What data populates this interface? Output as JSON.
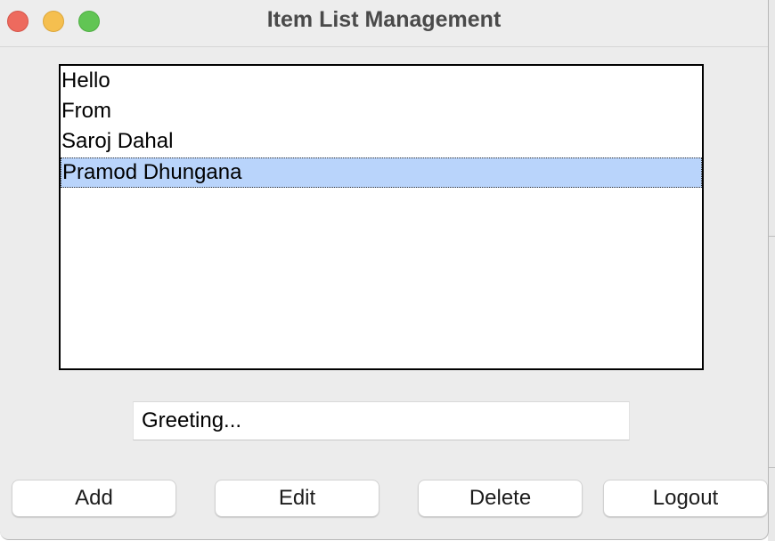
{
  "window": {
    "title": "Item List Management"
  },
  "titlebar": {
    "close_color": "#ED6A5E",
    "minimize_color": "#F5BF4F",
    "maximize_color": "#61C554"
  },
  "listbox": {
    "items": [
      {
        "label": "Hello",
        "selected": false
      },
      {
        "label": "From",
        "selected": false
      },
      {
        "label": "Saroj Dahal",
        "selected": false
      },
      {
        "label": "Pramod Dhungana",
        "selected": true
      }
    ],
    "selection_color": "#B9D4FB"
  },
  "entry": {
    "value": "Greeting..."
  },
  "buttons": {
    "add": "Add",
    "edit": "Edit",
    "delete": "Delete",
    "logout": "Logout"
  }
}
